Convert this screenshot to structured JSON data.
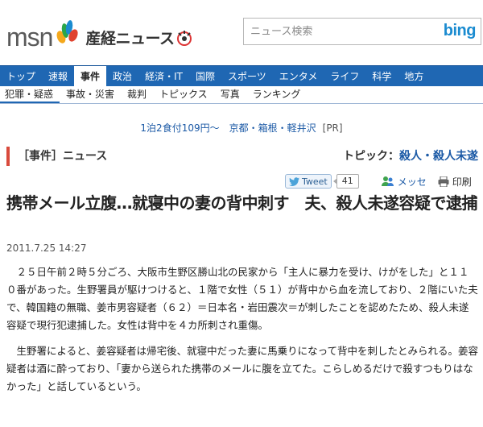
{
  "header": {
    "logo_msn": "msn",
    "logo_sankei": "産経ニュース",
    "search": {
      "placeholder": "ニュース検索",
      "button_label": "bing"
    }
  },
  "nav": {
    "tabs": [
      {
        "label": "トップ",
        "active": false
      },
      {
        "label": "速報",
        "active": false
      },
      {
        "label": "事件",
        "active": true
      },
      {
        "label": "政治",
        "active": false
      },
      {
        "label": "経済・IT",
        "active": false
      },
      {
        "label": "国際",
        "active": false
      },
      {
        "label": "スポーツ",
        "active": false
      },
      {
        "label": "エンタメ",
        "active": false
      },
      {
        "label": "ライフ",
        "active": false
      },
      {
        "label": "科学",
        "active": false
      },
      {
        "label": "地方",
        "active": false
      }
    ],
    "sub_items": [
      {
        "label": "犯罪・疑惑",
        "active": true
      },
      {
        "label": "事故・災害",
        "active": false
      },
      {
        "label": "裁判",
        "active": false
      },
      {
        "label": "トピックス",
        "active": false
      },
      {
        "label": "写真",
        "active": false
      },
      {
        "label": "ランキング",
        "active": false
      }
    ]
  },
  "ad": {
    "link1": "1泊2食付109円〜",
    "link2": "京都・箱根・軽井沢",
    "pr": "[PR]"
  },
  "section": {
    "title": "［事件］ニュース",
    "topic_label": "トピック：",
    "topic_link": "殺人・殺人未遂"
  },
  "tools": {
    "tweet_label": "Tweet",
    "tweet_count": "41",
    "mail_label": "メッセ",
    "print_label": "印刷"
  },
  "article": {
    "headline": "携帯メール立腹…就寝中の妻の背中刺す　夫、殺人未遂容疑で逮捕",
    "date": "2011.7.25 14:27",
    "paragraphs": [
      "２５日午前２時５分ごろ、大阪市生野区勝山北の民家から「主人に暴力を受け、けがをした」と１１０番があった。生野署員が駆けつけると、１階で女性（５１）が背中から血を流しており、２階にいた夫で、韓国籍の無職、姜市男容疑者（６２）＝日本名・岩田震次＝が刺したことを認めたため、殺人未遂容疑で現行犯逮捕した。女性は背中を４カ所刺され重傷。",
      "生野署によると、姜容疑者は帰宅後、就寝中だった妻に馬乗りになって背中を刺したとみられる。姜容疑者は酒に酔っており、「妻から送られた携帯のメールに腹を立てた。こらしめるだけで殺すつもりはなかった」と話しているという。"
    ]
  },
  "colors": {
    "nav_blue": "#1f67b3",
    "link_blue": "#1c5aa6",
    "section_accent": "#d94a3c"
  }
}
